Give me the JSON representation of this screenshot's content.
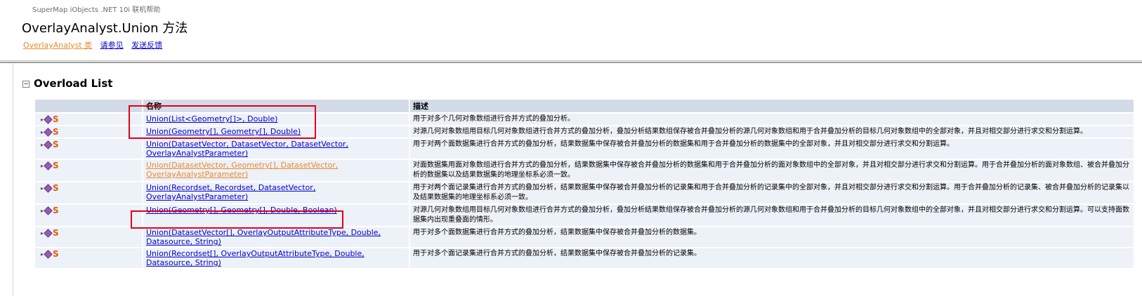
{
  "header": {
    "product": "SuperMap iObjects .NET 10i 联机帮助",
    "title": "OverlayAnalyst.Union 方法",
    "links": [
      "OverlayAnalyst 类",
      "请参见",
      "发送反馈"
    ]
  },
  "section": {
    "toggle": "⊟",
    "title": "Overload List"
  },
  "table": {
    "headers": [
      "",
      "名称",
      "描述"
    ],
    "static_marker": "S",
    "rows": [
      {
        "name": "Union(List<Geometry[]>, Double)",
        "desc": "用于对多个几何对象数组进行合并方式的叠加分析。",
        "visited": false
      },
      {
        "name": "Union(Geometry[], Geometry[], Double)",
        "desc": "对源几何对象数组用目标几何对象数组进行合并方式的叠加分析，叠加分析结果数组保存被合并叠加分析的源几何对象数组和用于合并叠加分析的目标几何对象数组中的全部对象，并且对相交部分进行求交和分割运算。",
        "visited": false
      },
      {
        "name": "Union(DatasetVector, DatasetVector, DatasetVector, OverlayAnalystParameter)",
        "desc": "用于对两个面数据集进行合并方式的叠加分析，结果数据集中保存被合并叠加分析的数据集和用于合并叠加分析的数据集中的全部对象，并且对相交部分进行求交和分割运算。",
        "visited": false
      },
      {
        "name": "Union(DatasetVector, Geometry[], DatasetVector, OverlayAnalystParameter)",
        "desc": "对面数据集用面对象数组进行合并方式的叠加分析，结果数据集中保存被合并叠加分析的数据集和用于合并叠加分析的面对象数组中的全部对象，并且对相交部分进行求交和分割运算。用于合并叠加分析的面对象数组、被合并叠加分析的数据集以及结果数据集的地理坐标系必须一致。",
        "visited": true
      },
      {
        "name": "Union(Recordset, Recordset, DatasetVector, OverlayAnalystParameter)",
        "desc": "用于对两个面记录集进行合并方式的叠加分析，结果数据集中保存被合并叠加分析的记录集和用于合并叠加分析的记录集中的全部对象，并且对相交部分进行求交和分割运算。用于合并叠加分析的记录集、被合并叠加分析的记录集以及结果数据集的地理坐标系必须一致。",
        "visited": false
      },
      {
        "name": "Union(Geometry[], Geometry[], Double, Boolean)",
        "desc": "对源几何对象数组用目标几何对象数组进行合并方式的叠加分析，叠加分析结果数组保存被合并叠加分析的源几何对象数组和用于合并叠加分析的目标几何对象数组中的全部对象，并且对相交部分进行求交和分割运算。可以支持面数据集内出现重叠面的情形。",
        "visited": false
      },
      {
        "name": "Union(DatasetVector[], OverlayOutputAttributeType, Double, Datasource, String)",
        "desc": "用于对多个面数据集进行合并方式的叠加分析，结果数据集中保存被合并叠加分析的数据集。",
        "visited": false
      },
      {
        "name": "Union(Recordset[], OverlayOutputAttributeType, Double, Datasource, String)",
        "desc": "用于对多个面记录集进行合并方式的叠加分析，结果数据集中保存被合并叠加分析的记录集。",
        "visited": false
      }
    ]
  },
  "colors": {
    "highlight": "#e0001b",
    "link": "#0000cc",
    "visited_link": "#e98a2e",
    "header_bg": "#d4dbe8",
    "row_bg": "#edf1f8"
  }
}
